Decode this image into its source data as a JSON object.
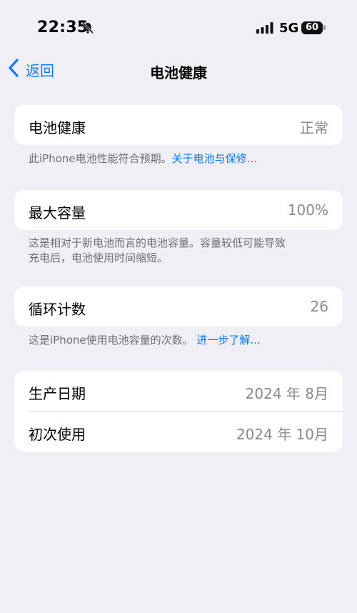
{
  "status_bar": {
    "time": "22:35",
    "network": "5G",
    "battery": "60"
  },
  "nav": {
    "back_label": "返回",
    "title": "电池健康"
  },
  "battery_health": {
    "label": "电池健康",
    "value": "正常",
    "footnote_text": "此iPhone电池性能符合预期。",
    "footnote_link": "关于电池与保修..."
  },
  "max_capacity": {
    "label": "最大容量",
    "value": "100%",
    "footnote_line1": "这是相对于新电池而言的电池容量。容量较低可能导致",
    "footnote_line2": "充电后，电池使用时间缩短。"
  },
  "cycle_count": {
    "label": "循环计数",
    "value": "26",
    "footnote_text": "这是iPhone使用电池容量的次数。",
    "footnote_link": "进一步了解..."
  },
  "dates": {
    "manufacture_label": "生产日期",
    "manufacture_value": "2024 年 8月",
    "first_use_label": "初次使用",
    "first_use_value": "2024 年 10月"
  },
  "colors": {
    "accent": "#0a7aff",
    "background": "#f0eff5",
    "secondary_text": "#8a8a8e"
  }
}
